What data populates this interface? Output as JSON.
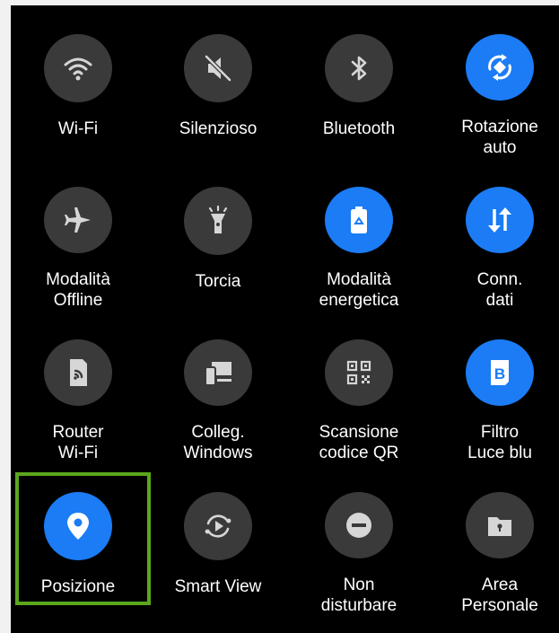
{
  "colors": {
    "panel_bg": "#000000",
    "tile_off": "#3a3a3a",
    "tile_on": "#1b7cf5",
    "highlight": "#5aa71c"
  },
  "tiles": [
    {
      "label": "Wi-Fi",
      "icon": "wifi-icon",
      "active": false
    },
    {
      "label": "Silenzioso",
      "icon": "mute-icon",
      "active": false
    },
    {
      "label": "Bluetooth",
      "icon": "bluetooth-icon",
      "active": false
    },
    {
      "label": "Rotazione\nauto",
      "icon": "auto-rotate-icon",
      "active": true
    },
    {
      "label": "Modalità\nOffline",
      "icon": "airplane-icon",
      "active": false
    },
    {
      "label": "Torcia",
      "icon": "flashlight-icon",
      "active": false
    },
    {
      "label": "Modalità\nenergetica",
      "icon": "battery-saver-icon",
      "active": true
    },
    {
      "label": "Conn.\ndati",
      "icon": "mobile-data-icon",
      "active": true
    },
    {
      "label": "Router\nWi-Fi",
      "icon": "hotspot-icon",
      "active": false
    },
    {
      "label": "Colleg.\nWindows",
      "icon": "link-windows-icon",
      "active": false
    },
    {
      "label": "Scansione\ncodice QR",
      "icon": "qr-code-icon",
      "active": false
    },
    {
      "label": "Filtro\nLuce blu",
      "icon": "blue-light-filter-icon",
      "active": true
    },
    {
      "label": "Posizione",
      "icon": "location-icon",
      "active": true,
      "highlighted": true
    },
    {
      "label": "Smart View",
      "icon": "smart-view-icon",
      "active": false
    },
    {
      "label": "Non\ndisturbare",
      "icon": "do-not-disturb-icon",
      "active": false
    },
    {
      "label": "Area\nPersonale",
      "icon": "secure-folder-icon",
      "active": false
    }
  ]
}
